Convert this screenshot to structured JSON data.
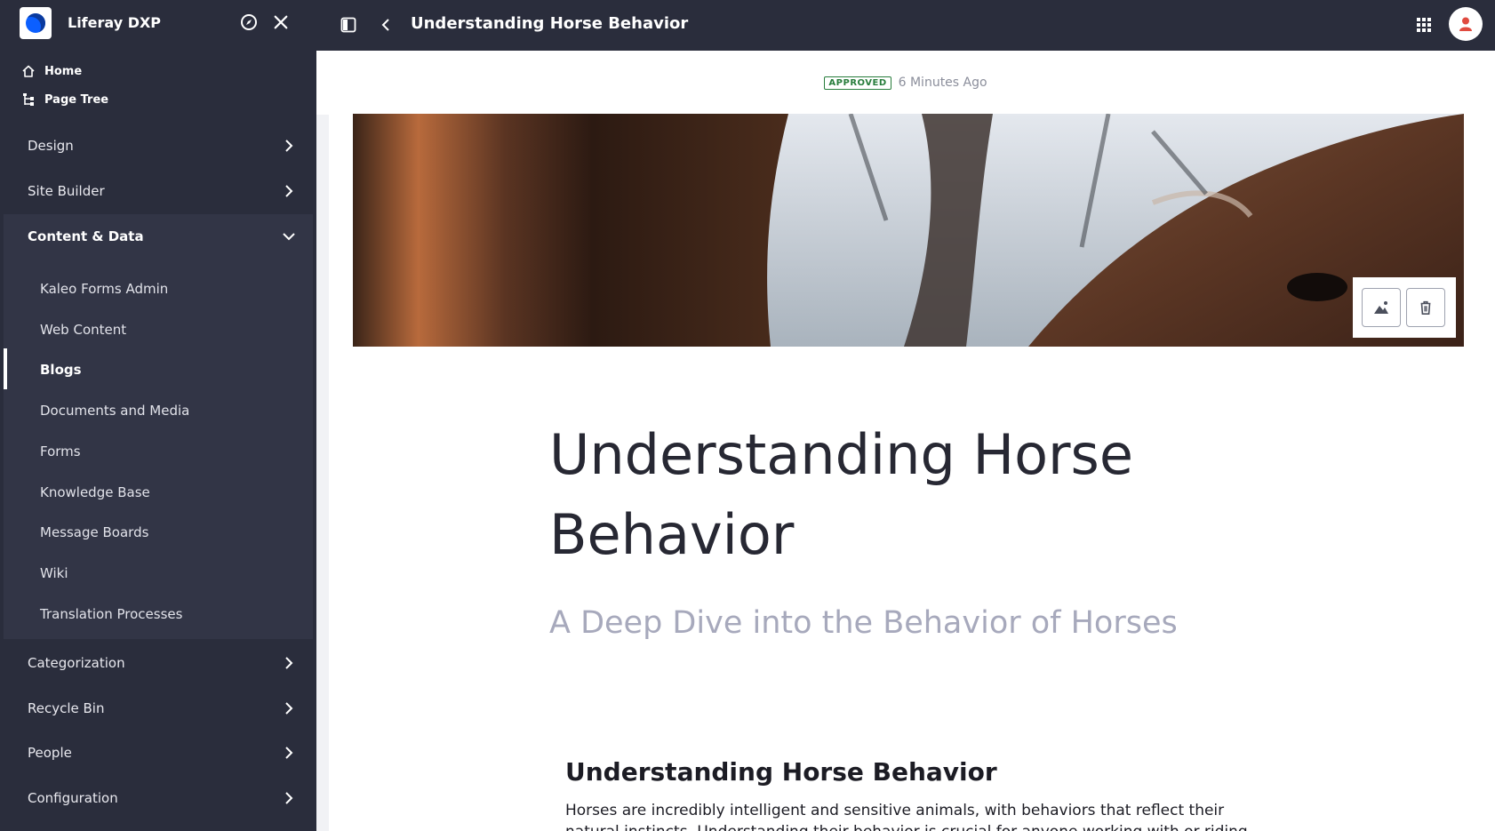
{
  "sidebar": {
    "title": "Liferay DXP",
    "quick_links": [
      {
        "label": "Home",
        "icon": "home-icon"
      },
      {
        "label": "Page Tree",
        "icon": "page-tree-icon"
      }
    ],
    "sections": [
      {
        "label": "Design"
      },
      {
        "label": "Site Builder"
      },
      {
        "label": "Content & Data",
        "expanded": true
      },
      {
        "label": "Categorization"
      },
      {
        "label": "Recycle Bin"
      },
      {
        "label": "People"
      },
      {
        "label": "Configuration"
      }
    ],
    "content_items": [
      {
        "label": "Kaleo Forms Admin"
      },
      {
        "label": "Web Content"
      },
      {
        "label": "Blogs",
        "active": true
      },
      {
        "label": "Documents and Media"
      },
      {
        "label": "Forms"
      },
      {
        "label": "Knowledge Base"
      },
      {
        "label": "Message Boards"
      },
      {
        "label": "Wiki"
      },
      {
        "label": "Translation Processes"
      }
    ]
  },
  "topbar": {
    "title": "Understanding Horse Behavior"
  },
  "status": {
    "badge": "APPROVED",
    "time": "6 Minutes Ago"
  },
  "post": {
    "title": "Understanding Horse Behavior",
    "subtitle": "A Deep Dive into the Behavior of Horses",
    "content_heading": "Understanding Horse Behavior",
    "content_body": "Horses are incredibly intelligent and sensitive animals, with behaviors that reflect their natural instincts. Understanding their behavior is crucial for anyone working with or riding horses."
  },
  "colors": {
    "sidebar_bg": "#2a2d3c",
    "approved": "#287d3c",
    "avatar_red": "#e04a3f"
  }
}
